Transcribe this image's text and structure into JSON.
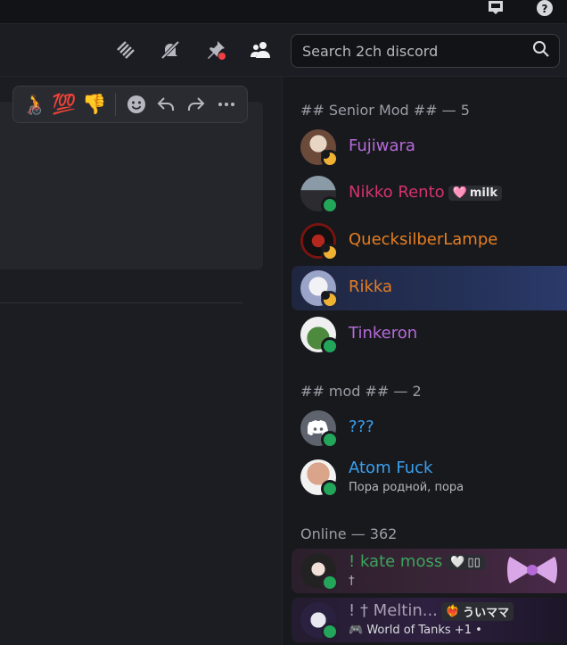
{
  "topbar": {
    "inbox_icon": "inbox-icon",
    "help_icon": "help-icon"
  },
  "header": {
    "icons": [
      "threads-icon",
      "notifications-muted-icon",
      "pinned-icon",
      "member-list-icon"
    ],
    "search": {
      "placeholder": "Search 2ch discord",
      "icon": "search-icon"
    }
  },
  "reactions": {
    "emojis": [
      "🧑‍🦽",
      "💯",
      "👎"
    ],
    "actions": [
      "add-reaction-icon",
      "reply-icon",
      "forward-icon",
      "more-icon"
    ]
  },
  "members": {
    "sections": [
      {
        "title": "## Senior Mod ## — 5"
      },
      {
        "title": "## mod ## — 2"
      },
      {
        "title": "Online — 362"
      }
    ],
    "list": [
      {
        "name": "Fujiwara",
        "color": "#b56ad8",
        "status": "idle"
      },
      {
        "name": "Nikko Rento",
        "color": "#d6336c",
        "status": "online",
        "badge": {
          "emoji": "🩷",
          "text": "milk"
        }
      },
      {
        "name": "QuecksilberLampe",
        "color": "#e67e22",
        "status": "idle"
      },
      {
        "name": "Rikka",
        "color": "#e67e22",
        "status": "idle"
      },
      {
        "name": "Tinkeron",
        "color": "#b56ad8",
        "status": "online"
      },
      {
        "name": "???",
        "color": "#3aa0f0",
        "status": "online"
      },
      {
        "name": "Atom Fuck",
        "color": "#3aa0f0",
        "status": "online",
        "sub": "Пора родной, пора"
      },
      {
        "name": "! kate moss",
        "color": "#3ba55c",
        "status": "online",
        "badge": {
          "emoji": "🤍",
          "text": "▯▯"
        },
        "sub": "†"
      },
      {
        "name": "! † Мeltin...",
        "color": "#a9a0b4",
        "status": "online",
        "badge": {
          "emoji": "❤️‍🔥",
          "text": "ういママ"
        },
        "sub": "World of Tanks +1 •"
      }
    ]
  }
}
